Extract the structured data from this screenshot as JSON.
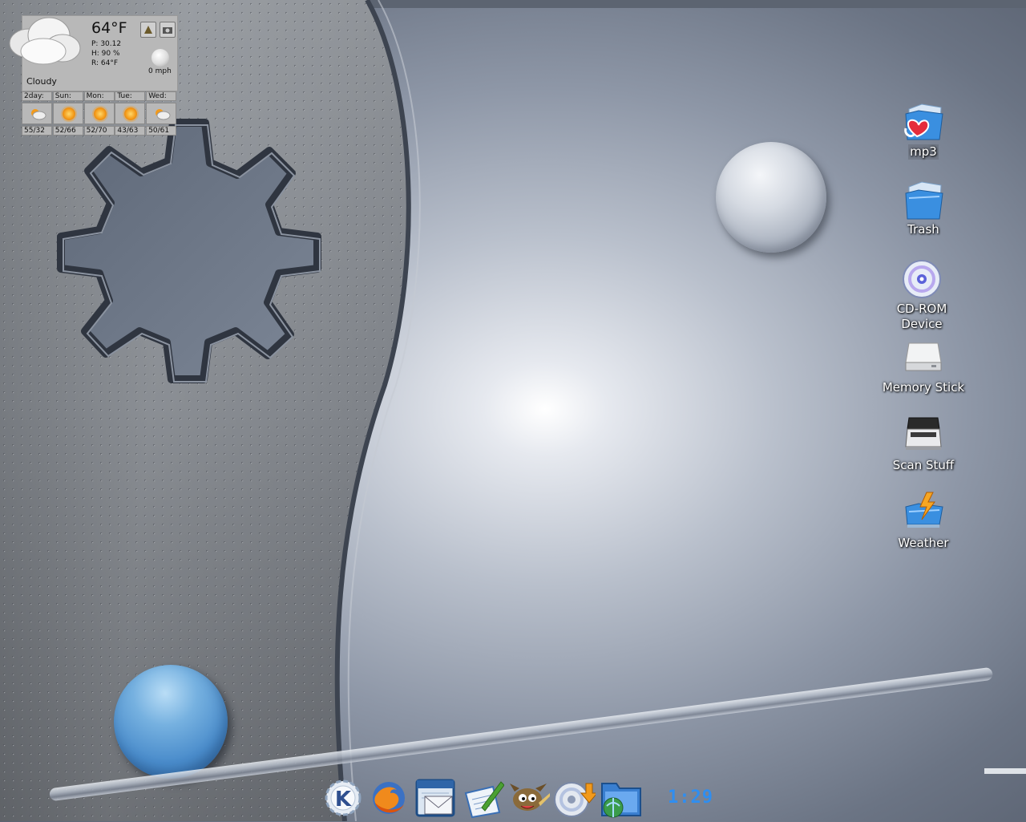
{
  "weather_widget": {
    "temperature": "64°F",
    "pressure": "P:  30.12",
    "humidity": "H:  90 %",
    "realfeel": "R:  64°F",
    "wind": "0 mph",
    "condition": "Cloudy",
    "forecast": [
      {
        "day": "2day:",
        "temps": "55/32",
        "icon": "partly-cloudy-icon"
      },
      {
        "day": "Sun:",
        "temps": "52/66",
        "icon": "sun-icon"
      },
      {
        "day": "Mon:",
        "temps": "52/70",
        "icon": "sun-icon"
      },
      {
        "day": "Tue:",
        "temps": "43/63",
        "icon": "sun-icon"
      },
      {
        "day": "Wed:",
        "temps": "50/61",
        "icon": "partly-cloudy-icon"
      }
    ]
  },
  "desktop_icons": [
    {
      "label": "mp3",
      "icon": "folder-heart-icon"
    },
    {
      "label": "Trash",
      "icon": "folder-icon"
    },
    {
      "label": "CD-ROM\nDevice",
      "icon": "cdrom-icon"
    },
    {
      "label": "Memory Stick",
      "icon": "drive-icon"
    },
    {
      "label": "Scan Stuff",
      "icon": "scanner-icon"
    },
    {
      "label": "Weather",
      "icon": "folder-lightning-icon"
    }
  ],
  "taskbar": {
    "icons": [
      "kde-menu-icon",
      "firefox-icon",
      "calendar-mail-icon",
      "text-editor-icon",
      "gimp-icon",
      "cd-burner-icon",
      "file-manager-icon"
    ],
    "clock": "1:29"
  },
  "colors": {
    "clock": "#2f8ef0",
    "folder_blue": "#3a8fe0"
  }
}
